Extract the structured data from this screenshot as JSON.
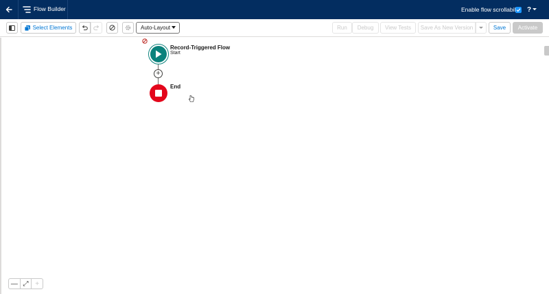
{
  "header": {
    "app_title": "Flow Builder",
    "scroll_toggle_label": "Enable flow scrollability",
    "scroll_toggle_checked": true,
    "help_label": "?"
  },
  "toolbar": {
    "select_elements_label": "Select Elements",
    "layout_select_value": "Auto-Layout",
    "run_label": "Run",
    "debug_label": "Debug",
    "view_tests_label": "View Tests",
    "save_as_label": "Save As New Version",
    "save_label": "Save",
    "activate_label": "Activate"
  },
  "canvas": {
    "start_title": "Record-Triggered Flow",
    "start_subtitle": "Start",
    "end_label": "End",
    "add_symbol": "+"
  },
  "zoom": {
    "out_symbol": "—",
    "fit_symbol": "⤢",
    "in_symbol": "+"
  },
  "colors": {
    "header_bg": "#032d60",
    "start_node": "#0b827c",
    "end_node": "#e3061b",
    "brand": "#0176d3"
  }
}
